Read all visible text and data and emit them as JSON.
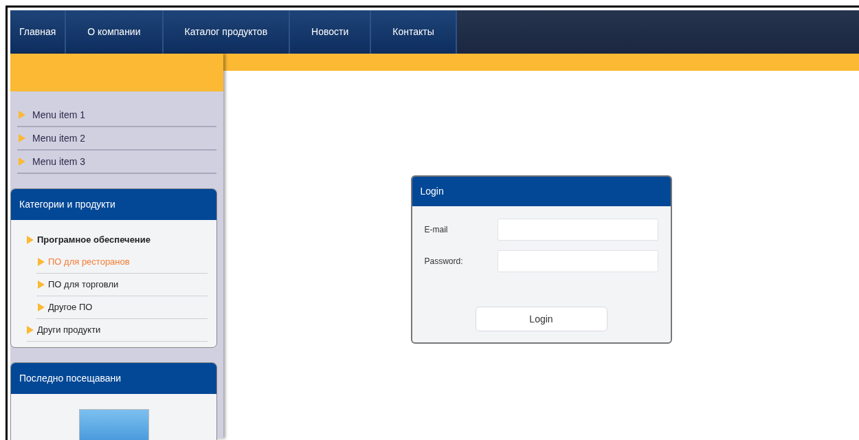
{
  "nav": [
    {
      "label": "Главная"
    },
    {
      "label": "О компании"
    },
    {
      "label": "Каталог продуктов"
    },
    {
      "label": "Новости"
    },
    {
      "label": "Контакты"
    }
  ],
  "menu": [
    {
      "label": "Menu item 1"
    },
    {
      "label": "Menu item 2"
    },
    {
      "label": "Menu item 3"
    }
  ],
  "categories": {
    "title": "Категории и продукти",
    "tree": [
      {
        "label": "Програмное обеспечение",
        "expanded": true,
        "selected": false,
        "children": [
          {
            "label": "ПО для ресторанов",
            "selected": true
          },
          {
            "label": "ПО для торговли",
            "selected": false
          },
          {
            "label": "Другое ПО",
            "selected": false
          }
        ]
      },
      {
        "label": "Други продукти",
        "expanded": false,
        "selected": false
      }
    ]
  },
  "recent": {
    "title": "Последно посещавани"
  },
  "login": {
    "title": "Login",
    "fields": [
      {
        "label": "E-mail"
      },
      {
        "label": "Password:"
      }
    ],
    "button": "Login"
  }
}
